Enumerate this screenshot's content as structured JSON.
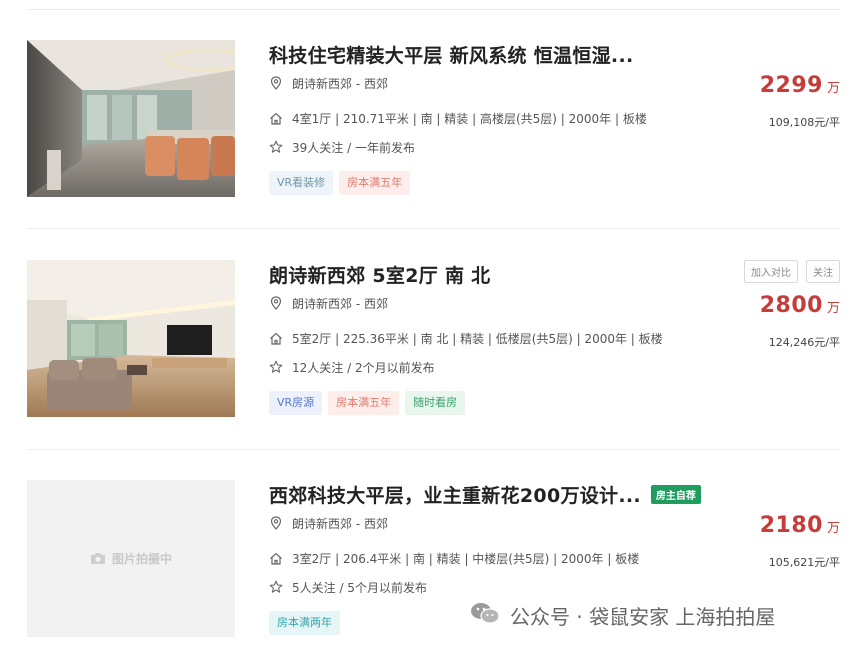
{
  "listings": [
    {
      "title": "科技住宅精装大平层 新风系统 恒温恒湿...",
      "location": "朗诗新西郊 - 西郊",
      "specs": "4室1厅 | 210.71平米 | 南 | 精装 | 高楼层(共5层) | 2000年 | 板楼",
      "follow": "39人关注 / 一年前发布",
      "tags": [
        "VR看装修",
        "房本满五年"
      ],
      "price": "2299",
      "price_unit": "万",
      "unit_price": "109,108元/平"
    },
    {
      "title": "朗诗新西郊 5室2厅 南 北",
      "location": "朗诗新西郊 - 西郊",
      "specs": "5室2厅 | 225.36平米 | 南 北 | 精装 | 低楼层(共5层) | 2000年 | 板楼",
      "follow": "12人关注 / 2个月以前发布",
      "tags": [
        "VR房源",
        "房本满五年",
        "随时看房"
      ],
      "price": "2800",
      "price_unit": "万",
      "unit_price": "124,246元/平",
      "actions": [
        "加入对比",
        "关注"
      ]
    },
    {
      "title": "西郊科技大平层，业主重新花200万设计...",
      "owner_badge": "房主自荐",
      "location": "朗诗新西郊 - 西郊",
      "specs": "3室2厅 | 206.4平米 | 南 | 精装 | 中楼层(共5层) | 2000年 | 板楼",
      "follow": "5人关注 / 5个月以前发布",
      "tags": [
        "房本满两年"
      ],
      "price": "2180",
      "price_unit": "万",
      "unit_price": "105,621元/平",
      "photo_placeholder": "图片拍摄中"
    }
  ],
  "watermark": "公众号 · 袋鼠安家 上海拍拍屋",
  "colors": {
    "price": "#c43d3a",
    "owner_badge": "#1f9d5e"
  },
  "icons": {
    "location": "location-pin-icon",
    "specs": "house-icon",
    "follow": "star-icon",
    "camera": "camera-icon",
    "wechat": "wechat-icon"
  }
}
